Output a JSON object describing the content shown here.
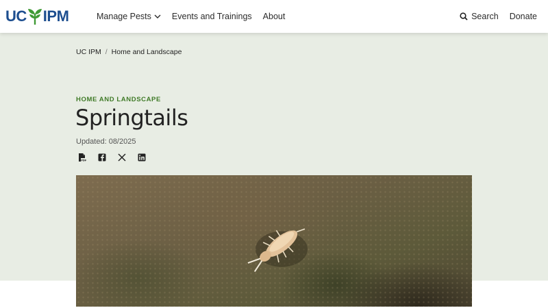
{
  "header": {
    "logo_text_left": "UC",
    "logo_text_right": "IPM",
    "logo_alt": "UC IPM",
    "nav": [
      {
        "label": "Manage Pests",
        "has_dropdown": true
      },
      {
        "label": "Events and Trainings"
      },
      {
        "label": "About"
      }
    ],
    "search_label": "Search",
    "donate_label": "Donate"
  },
  "breadcrumb": {
    "items": [
      "UC IPM",
      "Home and Landscape"
    ],
    "separator": "/"
  },
  "article": {
    "eyebrow": "HOME AND LANDSCAPE",
    "title": "Springtails",
    "updated": "Updated: 08/2025"
  },
  "share_icons": [
    "pdf-icon",
    "facebook-icon",
    "x-icon",
    "linkedin-icon"
  ],
  "colors": {
    "brand_blue": "#1d4e8f",
    "brand_green": "#3f9a35",
    "eyebrow_green": "#3f7a27",
    "hero_bg": "#e8ede4"
  }
}
